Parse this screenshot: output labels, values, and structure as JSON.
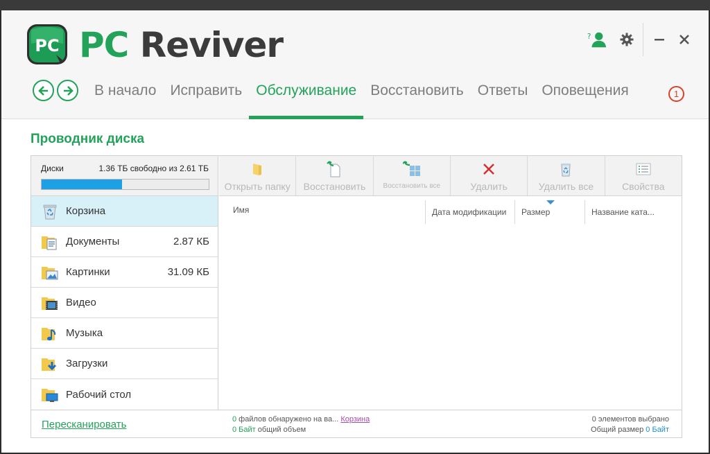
{
  "brand": {
    "pc": "PC",
    "rest": " Reviver",
    "logo_text": "PC"
  },
  "header": {
    "tabs": [
      {
        "label": "В начало",
        "active": false
      },
      {
        "label": "Исправить",
        "active": false
      },
      {
        "label": "Обслуживание",
        "active": true
      },
      {
        "label": "Восстановить",
        "active": false
      },
      {
        "label": "Ответы",
        "active": false
      },
      {
        "label": "Оповещения",
        "active": false
      }
    ],
    "notification_count": "1",
    "icons": [
      "help-user-icon",
      "gear-icon",
      "minimize-icon",
      "close-icon"
    ]
  },
  "section_title": "Проводник диска",
  "disks": {
    "label": "Диски",
    "free_text": "1.36 ТБ свободно из 2.61 ТБ",
    "used_fraction": 0.48
  },
  "sidebar": {
    "items": [
      {
        "label": "Корзина",
        "size": "",
        "icon": "recycle-bin-icon",
        "selected": true
      },
      {
        "label": "Документы",
        "size": "2.87 КБ",
        "icon": "documents-folder-icon"
      },
      {
        "label": "Картинки",
        "size": "31.09 КБ",
        "icon": "pictures-folder-icon"
      },
      {
        "label": "Видео",
        "size": "",
        "icon": "video-folder-icon"
      },
      {
        "label": "Музыка",
        "size": "",
        "icon": "music-folder-icon"
      },
      {
        "label": "Загрузки",
        "size": "",
        "icon": "downloads-folder-icon"
      },
      {
        "label": "Рабочий стол",
        "size": "",
        "icon": "desktop-folder-icon"
      }
    ]
  },
  "toolbar": {
    "open_folder": "Открыть папку",
    "restore": "Восстановить",
    "restore_all": "Восстановить все",
    "delete": "Удалить",
    "delete_all": "Удалить все",
    "properties": "Свойства"
  },
  "columns": {
    "name": "Имя",
    "modified": "Дата модификации",
    "size": "Размер",
    "catalog": "Название ката..."
  },
  "footer": {
    "rescan": "Пересканировать",
    "files_count": "0",
    "files_text": " файлов обнаружено на ва...",
    "location_link": "Корзина",
    "bytes_value": "0 Байт",
    "bytes_text": " общий объем",
    "selected_text": "0 элементов выбрано",
    "total_label": "Общий размер ",
    "total_value": "0 Байт"
  },
  "colors": {
    "accent": "#23a35a",
    "progress": "#1ea0e6",
    "alert": "#d9412b",
    "selected_row": "#d8f1f8"
  }
}
